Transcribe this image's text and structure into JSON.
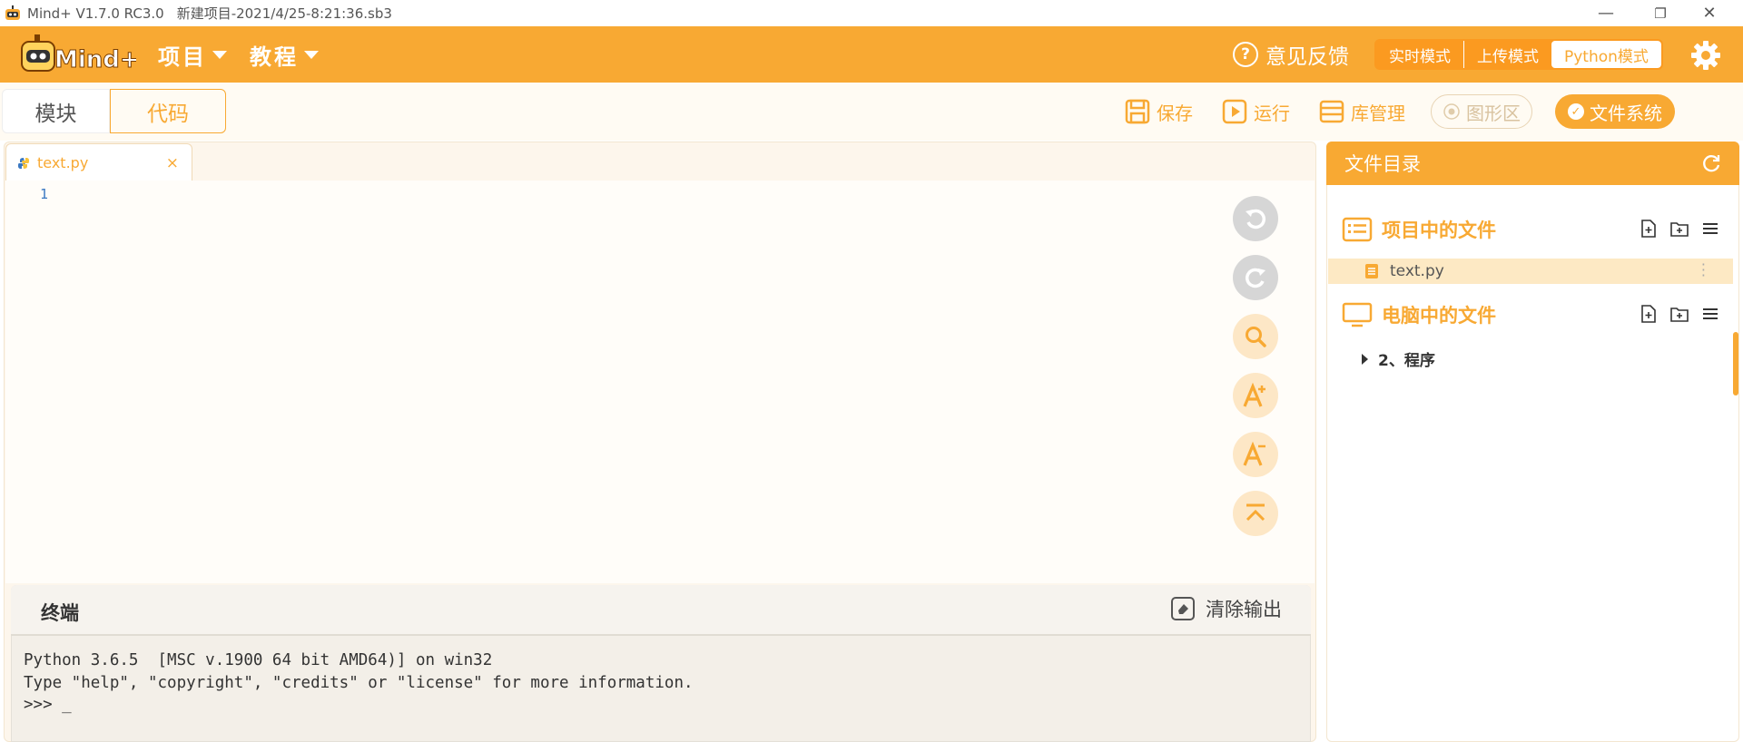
{
  "window": {
    "title": "Mind+ V1.7.0 RC3.0",
    "document": "新建项目-2021/4/25-8:21:36.sb3",
    "minimize": "—",
    "maximize": "❐",
    "close": "✕"
  },
  "header": {
    "logo_text": "Mind+",
    "menus": [
      "项目",
      "教程"
    ],
    "feedback": "意见反馈",
    "modes": [
      "实时模式",
      "上传模式",
      "Python模式"
    ],
    "active_mode": "Python模式"
  },
  "toolbar": {
    "tabs": [
      "模块",
      "代码"
    ],
    "save": "保存",
    "run": "运行",
    "library": "库管理",
    "graphics": "图形区",
    "filesystem": "文件系统"
  },
  "editor": {
    "tab_name": "text.py",
    "tab_close": "×",
    "line_numbers": [
      "1"
    ]
  },
  "terminal": {
    "title": "终端",
    "clear": "清除输出",
    "lines": [
      "Python 3.6.5  [MSC v.1900 64 bit AMD64)] on win32",
      "Type \"help\", \"copyright\", \"credits\" or \"license\" for more information.",
      ">>> _"
    ]
  },
  "file_manager": {
    "title": "文件目录",
    "project_section": "项目中的文件",
    "project_files": [
      "text.py"
    ],
    "computer_section": "电脑中的文件",
    "computer_tree": [
      "2、程序"
    ]
  },
  "colors": {
    "accent": "#f8a933",
    "highlight": "#fde9c4"
  }
}
